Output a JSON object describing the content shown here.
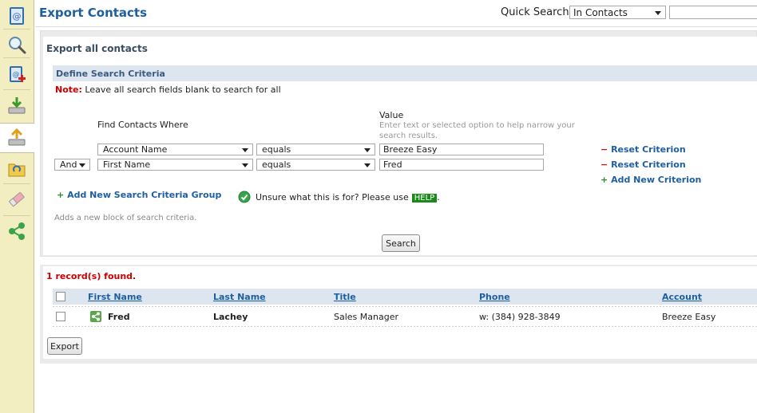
{
  "app": {
    "title": "Export Contacts"
  },
  "quick_search": {
    "label": "Quick Search",
    "scope": "In Contacts",
    "value": ""
  },
  "sidebar": {
    "items": [
      {
        "icon": "address-book-icon"
      },
      {
        "icon": "search-icon"
      },
      {
        "icon": "add-contact-icon"
      },
      {
        "icon": "import-icon"
      },
      {
        "icon": "export-icon"
      },
      {
        "icon": "folder-sync-icon"
      },
      {
        "icon": "eraser-icon"
      },
      {
        "icon": "share-icon"
      }
    ]
  },
  "panel": {
    "title": "Export all contacts",
    "criteria_title": "Define Search Criteria",
    "note_label": "Note:",
    "note_text": "Leave all search fields blank to search for all",
    "find_label": "Find Contacts Where",
    "value_label": "Value",
    "value_hint": "Enter text or selected option to help narrow your search results.",
    "criteria": [
      {
        "connector": "",
        "field": "Account Name",
        "operator": "equals",
        "value": "Breeze Easy",
        "reset": "Reset Criterion"
      },
      {
        "connector": "And",
        "field": "First Name",
        "operator": "equals",
        "value": "Fred",
        "reset": "Reset Criterion"
      }
    ],
    "add_criterion": "Add New Criterion",
    "add_group": "Add New Search Criteria Group",
    "help_prefix": "Unsure what this is for? Please use",
    "help_badge": "HELP",
    "help_suffix": ".",
    "adds_block": "Adds a new block of search criteria.",
    "search_button": "Search"
  },
  "results": {
    "found_text": "1 record(s) found.",
    "columns": [
      "First Name",
      "Last Name",
      "Title",
      "Phone",
      "Account"
    ],
    "rows": [
      {
        "first_name": "Fred",
        "last_name": "Lachey",
        "title": "Sales Manager",
        "phone": "w: (384) 928-3849",
        "account": "Breeze Easy"
      }
    ],
    "export_button": "Export"
  }
}
